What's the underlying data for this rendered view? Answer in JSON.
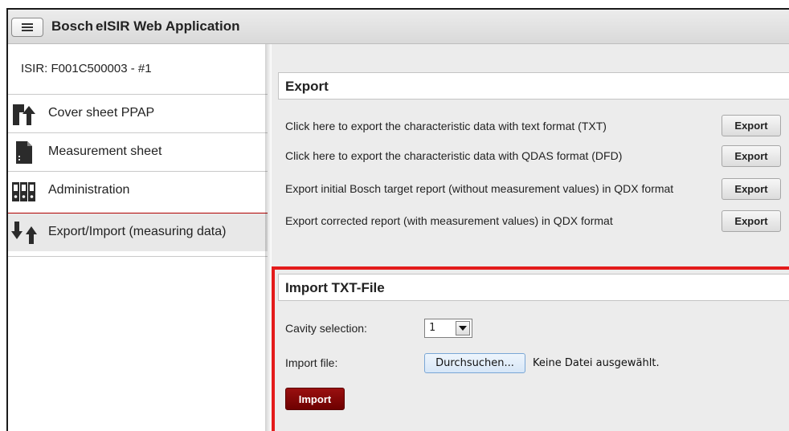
{
  "header": {
    "menu_icon": "hamburger-menu-icon",
    "brand": "Bosch",
    "title": "eISIR Web Application"
  },
  "sidebar": {
    "isir_title": "ISIR: F001C500003 - #1",
    "items": [
      {
        "label": "Cover sheet PPAP",
        "icon": "cover-sheet-arrow-icon",
        "active": false
      },
      {
        "label": "Measurement sheet",
        "icon": "document-icon",
        "active": false
      },
      {
        "label": "Administration",
        "icon": "binders-icon",
        "active": false
      },
      {
        "label": "Export/Import (measuring data)",
        "icon": "export-import-arrows-icon",
        "active": true
      }
    ]
  },
  "export_panel": {
    "title": "Export",
    "rows": [
      {
        "text": "Click here to export the characteristic data with text format (TXT)",
        "button": "Export"
      },
      {
        "text": "Click here to export the characteristic data with QDAS format (DFD)",
        "button": "Export"
      },
      {
        "text": "Export initial Bosch target report (without measurement values) in QDX format",
        "button": "Export"
      },
      {
        "text": "Export corrected report (with measurement values) in QDX format",
        "button": "Export"
      }
    ]
  },
  "import_panel": {
    "title": "Import TXT-File",
    "cavity_label": "Cavity selection:",
    "cavity_value": "1",
    "file_label": "Import file:",
    "browse_button": "Durchsuchen...",
    "no_file_text": "Keine Datei ausgewählt.",
    "import_button": "Import"
  },
  "colors": {
    "highlight_border": "#e31b1b",
    "import_button": "#7e0505",
    "active_nav_line": "#b00000"
  }
}
